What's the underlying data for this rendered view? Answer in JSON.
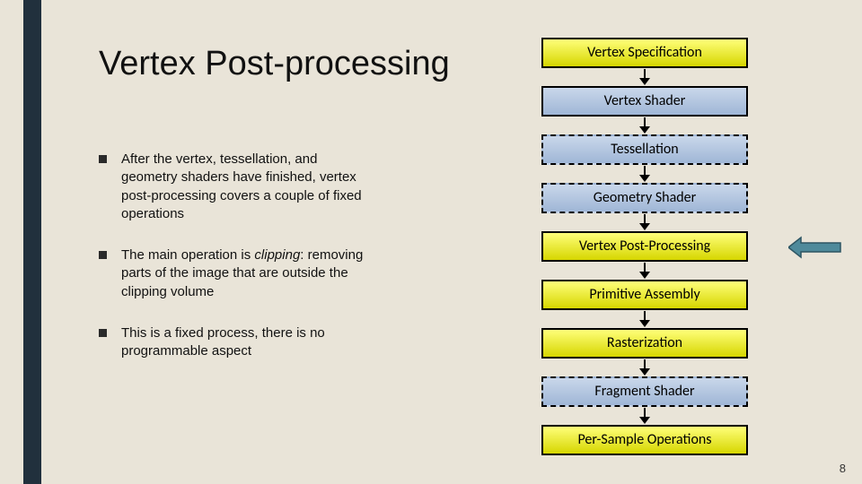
{
  "title": "Vertex Post-processing",
  "bullets": [
    "After the vertex, tessellation, and geometry shaders have finished, vertex post-processing covers a couple of fixed operations",
    "The main operation is <em>clipping</em>: removing parts of the image that are outside the clipping volume",
    "This is a fixed process, there is no programmable aspect"
  ],
  "pipeline": [
    {
      "label": "Vertex Specification",
      "style": "yellow",
      "dashed": false
    },
    {
      "label": "Vertex Shader",
      "style": "blue",
      "dashed": false
    },
    {
      "label": "Tessellation",
      "style": "blue",
      "dashed": true
    },
    {
      "label": "Geometry Shader",
      "style": "blue",
      "dashed": true
    },
    {
      "label": "Vertex Post-Processing",
      "style": "yellow",
      "dashed": false,
      "pointed": true
    },
    {
      "label": "Primitive Assembly",
      "style": "yellow",
      "dashed": false
    },
    {
      "label": "Rasterization",
      "style": "yellow",
      "dashed": false
    },
    {
      "label": "Fragment Shader",
      "style": "blue",
      "dashed": true
    },
    {
      "label": "Per-Sample Operations",
      "style": "yellow",
      "dashed": false
    }
  ],
  "page_number": "8"
}
